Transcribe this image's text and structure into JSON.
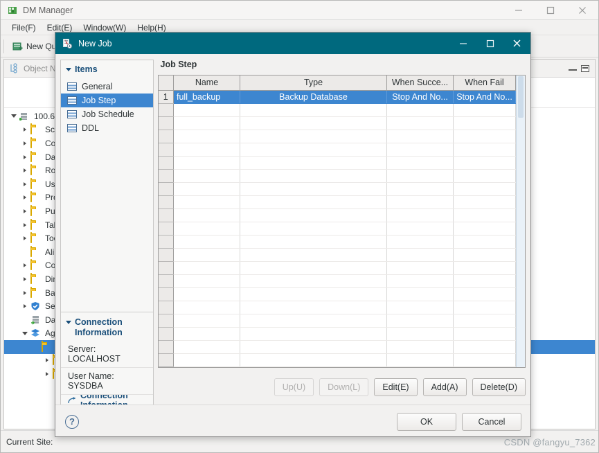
{
  "app": {
    "title": "DM Manager",
    "icon": "app-grid-icon",
    "window_controls": {
      "minimize": "minimize",
      "maximize": "maximize",
      "close": "close"
    },
    "menu": [
      {
        "label": "File(F)",
        "name": "menu-file"
      },
      {
        "label": "Edit(E)",
        "name": "menu-edit"
      },
      {
        "label": "Window(W)",
        "name": "menu-window"
      },
      {
        "label": "Help(H)",
        "name": "menu-help"
      }
    ],
    "toolbar": {
      "new_query_label": "New Qu",
      "new_query_icon": "new-query-icon"
    },
    "statusbar": {
      "current_site_label": "Current Site:"
    },
    "watermark": "CSDN @fangyu_7362"
  },
  "object_navigator": {
    "title": "Object Na",
    "icon": "object-navigator-icon",
    "controls": {
      "minimize": "minimize",
      "restore": "restore"
    },
    "tree": [
      {
        "label": "100.6",
        "icon": "server-icon",
        "indent": 0,
        "twisty": "open",
        "selected": false
      },
      {
        "label": "Sch",
        "icon": "folder-icon",
        "indent": 1,
        "twisty": "closed",
        "selected": false
      },
      {
        "label": "Co",
        "icon": "folder-icon",
        "indent": 1,
        "twisty": "closed",
        "selected": false
      },
      {
        "label": "Da",
        "icon": "folder-icon",
        "indent": 1,
        "twisty": "closed",
        "selected": false
      },
      {
        "label": "Rol",
        "icon": "folder-icon",
        "indent": 1,
        "twisty": "closed",
        "selected": false
      },
      {
        "label": "Us",
        "icon": "folder-icon",
        "indent": 1,
        "twisty": "closed",
        "selected": false
      },
      {
        "label": "Pro",
        "icon": "folder-icon",
        "indent": 1,
        "twisty": "closed",
        "selected": false
      },
      {
        "label": "Pub",
        "icon": "folder-icon",
        "indent": 1,
        "twisty": "closed",
        "selected": false
      },
      {
        "label": "Tab",
        "icon": "folder-icon",
        "indent": 1,
        "twisty": "closed",
        "selected": false
      },
      {
        "label": "Too",
        "icon": "folder-icon",
        "indent": 1,
        "twisty": "closed",
        "selected": false
      },
      {
        "label": "Ali",
        "icon": "folder-icon",
        "indent": 1,
        "twisty": "none",
        "selected": false
      },
      {
        "label": "Co",
        "icon": "folder-icon",
        "indent": 1,
        "twisty": "closed",
        "selected": false
      },
      {
        "label": "Dir",
        "icon": "folder-icon",
        "indent": 1,
        "twisty": "closed",
        "selected": false
      },
      {
        "label": "Ba",
        "icon": "folder-icon",
        "indent": 1,
        "twisty": "closed",
        "selected": false
      },
      {
        "label": "Se",
        "icon": "shield-icon",
        "indent": 1,
        "twisty": "closed",
        "selected": false
      },
      {
        "label": "Da",
        "icon": "migration-icon",
        "indent": 1,
        "twisty": "none",
        "selected": false
      },
      {
        "label": "Ag",
        "icon": "layers-icon",
        "indent": 1,
        "twisty": "open",
        "selected": false
      },
      {
        "label": "",
        "icon": "folder-icon",
        "indent": 2,
        "twisty": "none",
        "selected": true
      },
      {
        "label": "",
        "icon": "folder-icon",
        "indent": 3,
        "twisty": "closed",
        "selected": false
      },
      {
        "label": "",
        "icon": "folder-icon",
        "indent": 3,
        "twisty": "closed",
        "selected": false
      }
    ]
  },
  "dialog": {
    "title": "New Job",
    "icon": "new-job-icon",
    "window_controls": {
      "minimize": "minimize",
      "maximize": "maximize",
      "close": "close"
    },
    "items_section": {
      "header": "Items",
      "items": [
        {
          "label": "General",
          "selected": false
        },
        {
          "label": "Job Step",
          "selected": true
        },
        {
          "label": "Job Schedule",
          "selected": false
        },
        {
          "label": "DDL",
          "selected": false
        }
      ]
    },
    "connection_section": {
      "header": "Connection Information",
      "server": "Server: LOCALHOST",
      "user_name": "User Name: SYSDBA",
      "link": "Connection Information"
    },
    "pane": {
      "title": "Job Step",
      "columns": [
        "Name",
        "Type",
        "When Succe...",
        "When Fail"
      ],
      "rows": [
        {
          "num": "1",
          "name": "full_backup",
          "type": "Backup Database",
          "when_success": "Stop And No...",
          "when_fail": "Stop And No...",
          "selected": true
        }
      ],
      "empty_row_count": 21,
      "buttons": [
        {
          "label": "Up(U)",
          "enabled": false
        },
        {
          "label": "Down(L)",
          "enabled": false
        },
        {
          "label": "Edit(E)",
          "enabled": true
        },
        {
          "label": "Add(A)",
          "enabled": true
        },
        {
          "label": "Delete(D)",
          "enabled": true
        }
      ]
    },
    "footer": {
      "help": "?",
      "ok": "OK",
      "cancel": "Cancel"
    }
  },
  "colors": {
    "dialog_titlebar": "#00697e",
    "selection": "#3d86d0",
    "section_header": "#1a4f7a",
    "folder": "#f3c12c"
  }
}
